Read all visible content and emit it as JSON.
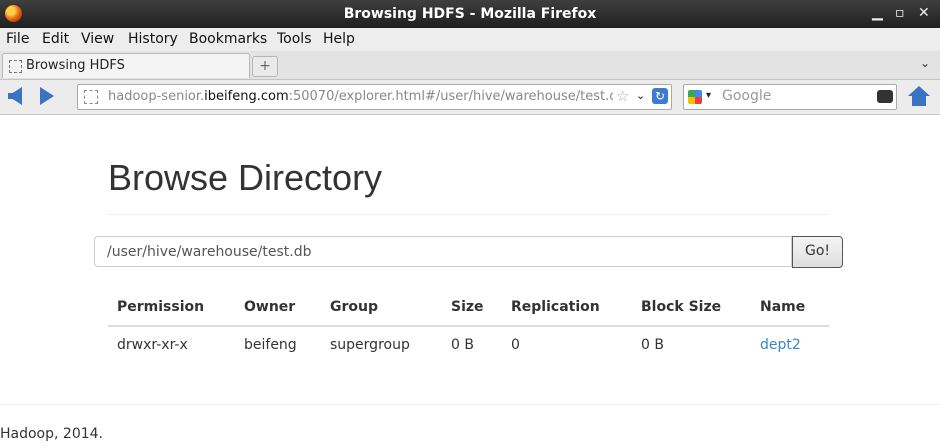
{
  "window": {
    "title": "Browsing HDFS - Mozilla Firefox",
    "min": "▁",
    "max": "▫",
    "close": "✕"
  },
  "menu": [
    "File",
    "Edit",
    "View",
    "History",
    "Bookmarks",
    "Tools",
    "Help"
  ],
  "tab": {
    "label": "Browsing HDFS",
    "new_tab": "+",
    "list": "⌄"
  },
  "address": {
    "prefix": "hadoop-senior.",
    "domain": "ibeifeng.com",
    "rest": ":50070/explorer.html#/user/hive/warehouse/test.c",
    "star": "☆",
    "dropdown": "⌄",
    "reload": "↻"
  },
  "search": {
    "placeholder": "Google",
    "dropdown": "▾"
  },
  "page": {
    "heading": "Browse Directory",
    "path_value": "/user/hive/warehouse/test.db",
    "go_label": "Go!",
    "columns": [
      "Permission",
      "Owner",
      "Group",
      "Size",
      "Replication",
      "Block Size",
      "Name"
    ],
    "rows": [
      {
        "permission": "drwxr-xr-x",
        "owner": "beifeng",
        "group": "supergroup",
        "size": "0 B",
        "replication": "0",
        "block_size": "0 B",
        "name": "dept2"
      }
    ],
    "footer": "Hadoop, 2014."
  },
  "colors": {
    "link": "#3a87c8",
    "nav_icon": "#3a72c4"
  }
}
